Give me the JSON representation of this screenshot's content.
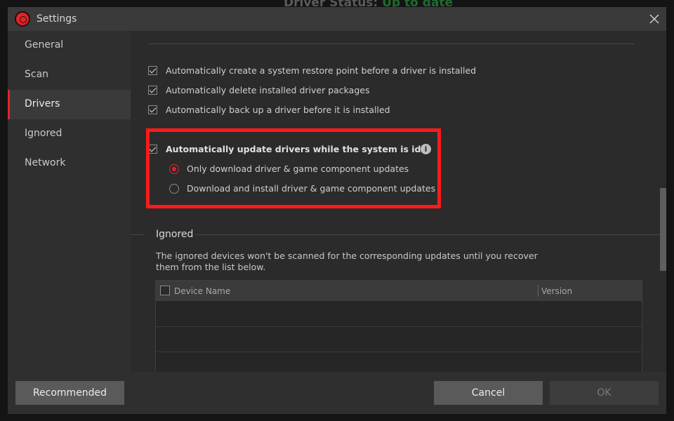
{
  "background_window": {
    "status_label": "Driver Status:",
    "status_value": "Up to date"
  },
  "window": {
    "title": "Settings",
    "close_icon": "close-icon",
    "logo_icon": "app-logo-icon"
  },
  "sidebar": {
    "items": [
      {
        "label": "General"
      },
      {
        "label": "Scan"
      },
      {
        "label": "Drivers",
        "active": true
      },
      {
        "label": "Ignored"
      },
      {
        "label": "Network"
      }
    ]
  },
  "drivers": {
    "options": [
      {
        "label": "Automatically create a system restore point before a driver is installed",
        "checked": true
      },
      {
        "label": "Automatically delete installed driver packages",
        "checked": true
      },
      {
        "label": "Automatically back up a driver before it is installed",
        "checked": true
      },
      {
        "label": "Automatically update drivers while the system is idle",
        "checked": true
      }
    ],
    "idle_mode": [
      {
        "label": "Only download driver & game component updates",
        "selected": true
      },
      {
        "label": "Download and install driver & game component updates",
        "selected": false
      }
    ],
    "info_icon": "info-icon"
  },
  "ignored": {
    "title": "Ignored",
    "description": "The ignored devices won't be scanned for the corresponding updates until you recover them from the list below.",
    "columns": [
      "Device Name",
      "Version"
    ],
    "rows": []
  },
  "footer": {
    "recommended_label": "Recommended",
    "cancel_label": "Cancel",
    "ok_label": "OK"
  },
  "colors": {
    "accent": "#e0242a",
    "highlight_box": "#ff1a1a",
    "dialog_bg": "#2b2b2b"
  }
}
